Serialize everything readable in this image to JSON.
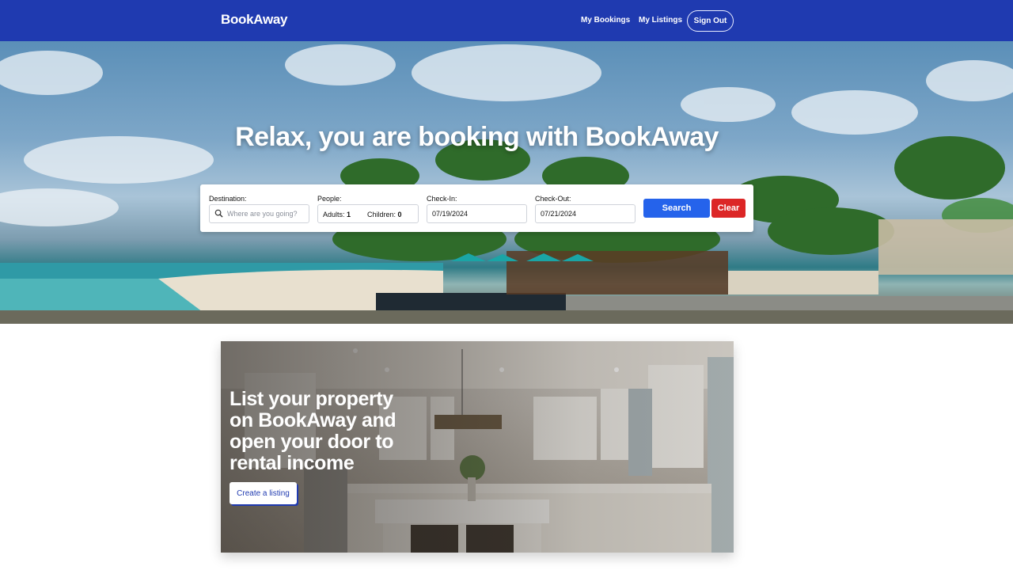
{
  "nav": {
    "brand": "BookAway",
    "links": [
      "My Bookings",
      "My Listings"
    ],
    "sign_out": "Sign Out"
  },
  "hero": {
    "title": "Relax, you are booking with BookAway"
  },
  "search": {
    "destination_label": "Destination:",
    "destination_placeholder": "Where are you going?",
    "people_label": "People:",
    "adults_label": "Adults:",
    "adults_value": "1",
    "children_label": "Children:",
    "children_value": "0",
    "checkin_label": "Check-In:",
    "checkin_value": "07/19/2024",
    "checkout_label": "Check-Out:",
    "checkout_value": "07/21/2024",
    "search_button": "Search",
    "clear_button": "Clear"
  },
  "promo": {
    "headline": "List your property on BookAway and open your door to rental income",
    "cta": "Create a listing"
  },
  "colors": {
    "nav_bg": "#1f3ab0",
    "search_button": "#2563eb",
    "clear_button": "#dc2626"
  },
  "icons": {
    "destination": "search-icon"
  }
}
